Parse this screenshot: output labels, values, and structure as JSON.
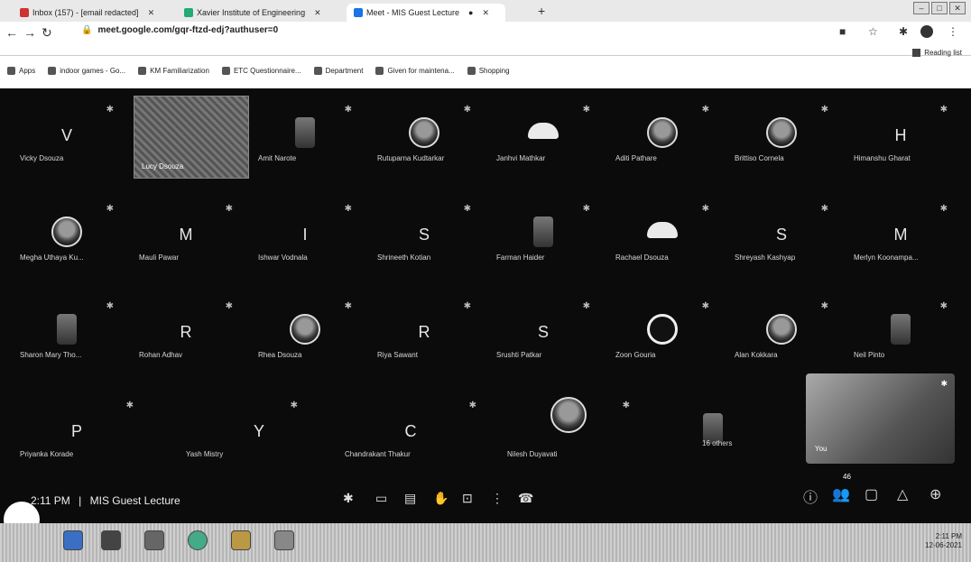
{
  "browser": {
    "tabs": [
      {
        "label": "Inbox (157) - [email redacted]"
      },
      {
        "label": "Xavier Institute of Engineering"
      },
      {
        "label": "Meet - MIS Guest Lecture"
      }
    ],
    "url": "meet.google.com/gqr-ftzd-edj?authuser=0",
    "bookmarks": [
      "Apps",
      "indoor games - Go...",
      "KM Familiarization",
      "ETC Questionnaire...",
      "Department",
      "Given for maintena...",
      "Shopping"
    ],
    "reading_list": "Reading list"
  },
  "participants": [
    {
      "name": "Vicky Dsouza",
      "initial": "V"
    },
    {
      "name": "Lucy Dsouza",
      "initial": ""
    },
    {
      "name": "Amit Narote",
      "initial": ""
    },
    {
      "name": "Rutuparna Kudtarkar",
      "initial": ""
    },
    {
      "name": "Janhvi Mathkar",
      "initial": ""
    },
    {
      "name": "Aditi Pathare",
      "initial": ""
    },
    {
      "name": "Brittiso Cornela",
      "initial": ""
    },
    {
      "name": "Himanshu Gharat",
      "initial": "H"
    },
    {
      "name": "Megha Uthaya Ku...",
      "initial": ""
    },
    {
      "name": "Mauli Pawar",
      "initial": "M"
    },
    {
      "name": "Ishwar Vodnala",
      "initial": "I"
    },
    {
      "name": "Shrineeth Kotian",
      "initial": "S"
    },
    {
      "name": "Farman Haider",
      "initial": ""
    },
    {
      "name": "Rachael Dsouza",
      "initial": ""
    },
    {
      "name": "Shreyash Kashyap",
      "initial": "S"
    },
    {
      "name": "Merlyn Koonampa...",
      "initial": "M"
    },
    {
      "name": "Sharon Mary Tho...",
      "initial": ""
    },
    {
      "name": "Rohan Adhav",
      "initial": "R"
    },
    {
      "name": "Rhea Dsouza",
      "initial": ""
    },
    {
      "name": "Riya Sawant",
      "initial": "R"
    },
    {
      "name": "Srushti Patkar",
      "initial": "S"
    },
    {
      "name": "Zoon Gouria",
      "initial": ""
    },
    {
      "name": "Alan Kokkara",
      "initial": ""
    },
    {
      "name": "Neil Pinto",
      "initial": ""
    },
    {
      "name": "Priyanka Korade",
      "initial": "P"
    },
    {
      "name": "Yash Mistry",
      "initial": "Y"
    },
    {
      "name": "Chandrakant Thakur",
      "initial": "C"
    },
    {
      "name": "Nilesh Duyavati",
      "initial": ""
    },
    {
      "name": "16 others",
      "initial": ""
    }
  ],
  "self_tile": {
    "name": "You"
  },
  "meeting": {
    "time": "2:11 PM",
    "separator": "|",
    "title": "MIS Guest Lecture"
  },
  "controls": {
    "participant_count": "46"
  },
  "taskbar": {
    "time": "2:11 PM",
    "date": "12-06-2021"
  }
}
